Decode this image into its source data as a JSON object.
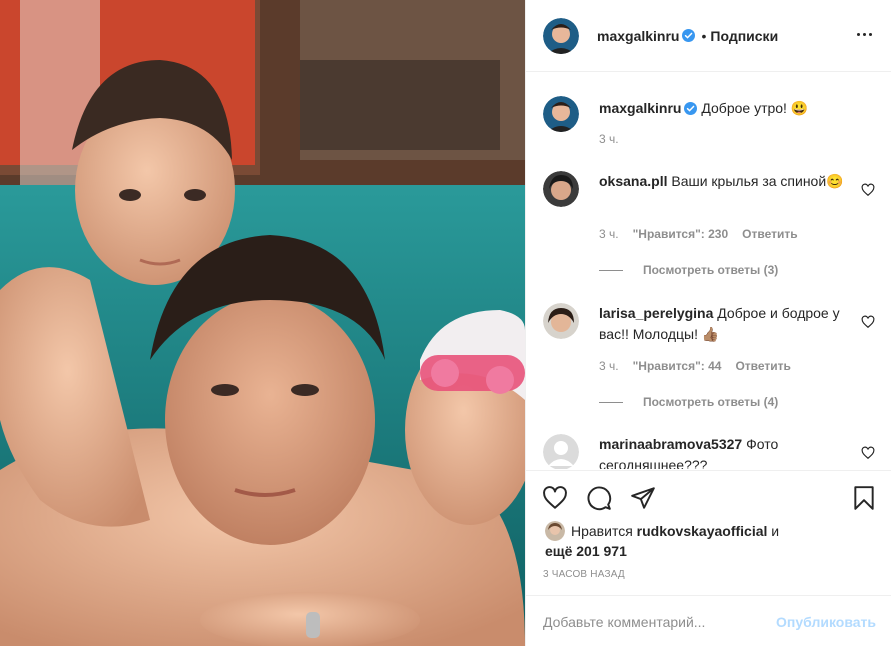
{
  "header": {
    "username": "maxgalkinru",
    "separator": "•",
    "follow_label": "Подписки"
  },
  "caption": {
    "username": "maxgalkinru",
    "text": "Доброе утро! 😃",
    "time": "3 ч."
  },
  "comments": [
    {
      "username": "oksana.pll",
      "text": "Ваши крылья за спиной😊",
      "time": "3 ч.",
      "likes": "\"Нравится\": 230",
      "reply": "Ответить",
      "view_replies": "Посмотреть ответы (3)"
    },
    {
      "username": "larisa_perelygina",
      "text": "Доброе и бодрое у вас!! Молодцы! 👍🏽",
      "time": "3 ч.",
      "likes": "\"Нравится\": 44",
      "reply": "Ответить",
      "view_replies": "Посмотреть ответы (4)"
    },
    {
      "username": "marinaabramova5327",
      "text": "Фото сегодняшнее???"
    }
  ],
  "likes": {
    "prefix": "Нравится",
    "user": "rudkovskayaofficial",
    "and": "и",
    "count": "ещё 201 971"
  },
  "posted_ago": "3 ЧАСОВ НАЗАД",
  "comment_box": {
    "placeholder": "Добавьте комментарий...",
    "publish_label": "Опубликовать"
  },
  "icons": {
    "like": "heart-icon",
    "comment": "comment-icon",
    "share": "share-icon",
    "save": "bookmark-icon",
    "more": "more-icon",
    "verified": "verified-badge-icon"
  },
  "colors": {
    "verified": "#3897f0",
    "publish_disabled": "#b3dbff",
    "secondary_text": "#8e8e8e"
  }
}
